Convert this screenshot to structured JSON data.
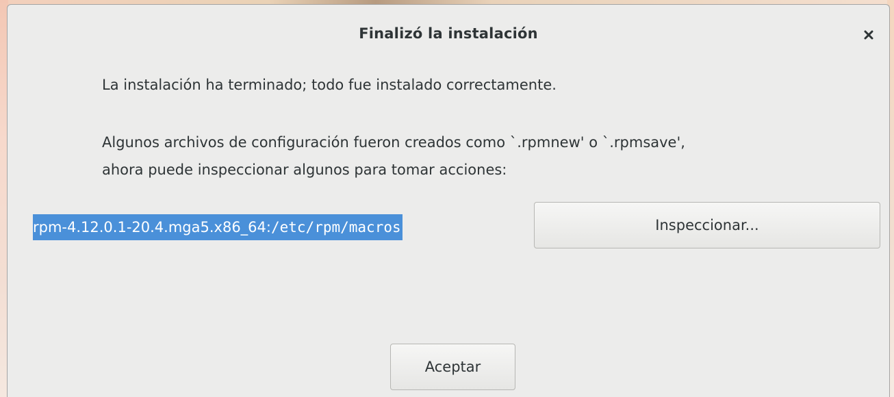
{
  "dialog": {
    "title": "Finalizó la instalación",
    "message_1": "La instalación ha terminado; todo fue instalado correctamente.",
    "message_2": "Algunos archivos de configuración fueron creados como `.rpmnew' o `.rpmsave',",
    "message_3": "ahora puede inspeccionar algunos para tomar acciones:",
    "file_entry": {
      "package": "rpm-4.12.0.1-20.4.mga5.x86_64:",
      "path": "/etc/rpm/macros"
    },
    "inspect_button_label": "Inspeccionar...",
    "accept_button_label": "Aceptar",
    "close_icon": "close-icon"
  },
  "colors": {
    "selection": "#4a90d9",
    "dialog_bg": "#ececeb",
    "text": "#2e3436"
  }
}
